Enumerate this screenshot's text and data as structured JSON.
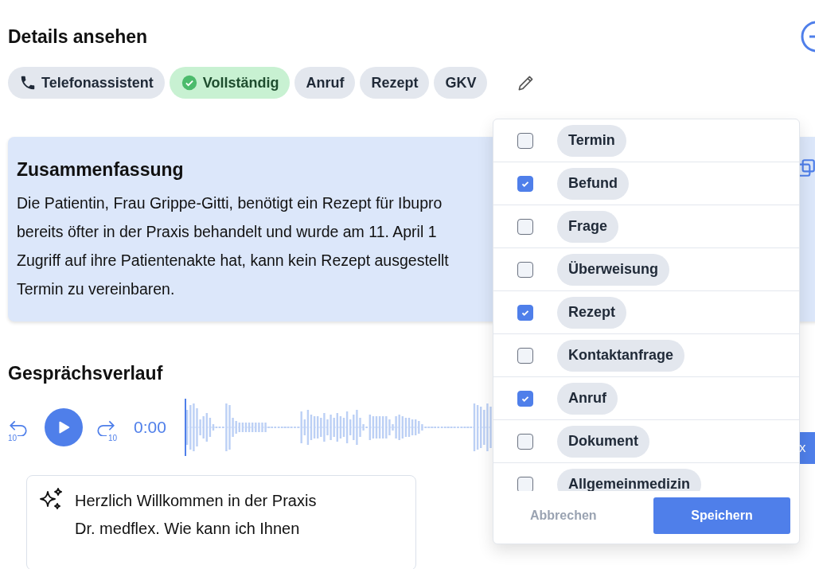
{
  "header": {
    "title": "Details ansehen"
  },
  "tags": [
    {
      "kind": "phone",
      "label": "Telefonassistent"
    },
    {
      "kind": "status",
      "label": "Vollständig"
    },
    {
      "kind": "plain",
      "label": "Anruf"
    },
    {
      "kind": "plain",
      "label": "Rezept"
    },
    {
      "kind": "plain",
      "label": "GKV"
    }
  ],
  "summary": {
    "title": "Zusammenfassung",
    "lines": [
      "Die Patientin, Frau Grippe-Gitti, benötigt ein Rezept für Ibupro",
      "bereits öfter in der Praxis behandelt und wurde am 11. April 1",
      "Zugriff auf ihre Patientenakte hat, kann kein Rezept ausgestellt",
      "Termin zu vereinbaren."
    ]
  },
  "conversation": {
    "title": "Gesprächsverlauf",
    "rewind_label": "10",
    "forward_label": "10",
    "time": "0:00",
    "speed_label": "x",
    "message": "Herzlich Willkommen in der Praxis Dr. medflex. Wie kann ich Ihnen"
  },
  "tag_menu": {
    "options": [
      {
        "label": "Termin",
        "checked": false
      },
      {
        "label": "Befund",
        "checked": true
      },
      {
        "label": "Frage",
        "checked": false
      },
      {
        "label": "Überweisung",
        "checked": false
      },
      {
        "label": "Rezept",
        "checked": true
      },
      {
        "label": "Kontaktanfrage",
        "checked": false
      },
      {
        "label": "Anruf",
        "checked": true
      },
      {
        "label": "Dokument",
        "checked": false
      },
      {
        "label": "Allgemeinmedizin",
        "checked": false
      }
    ],
    "cancel": "Abbrechen",
    "save": "Speichern"
  }
}
